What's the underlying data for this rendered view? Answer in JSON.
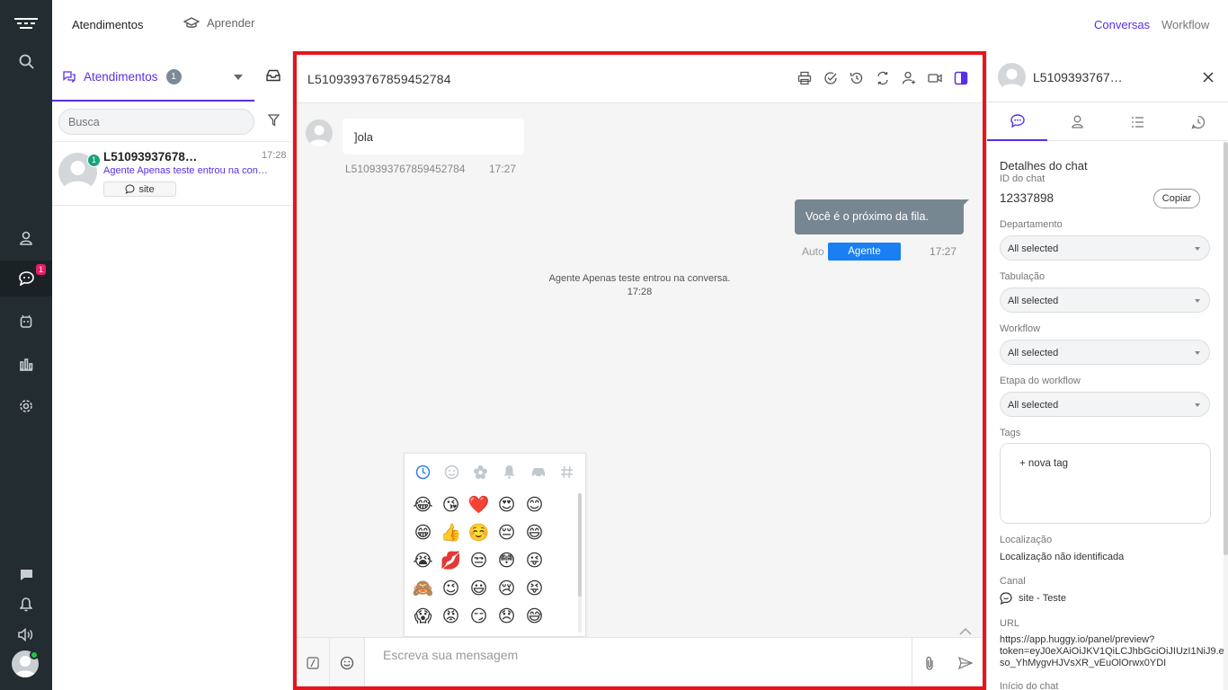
{
  "rail": {
    "items": [
      {
        "name": "huggy-logo-icon"
      },
      {
        "name": "search-icon"
      },
      {
        "name": "contacts-icon"
      },
      {
        "name": "chat-icon",
        "badge": "1"
      },
      {
        "name": "bot-icon"
      },
      {
        "name": "reports-icon"
      },
      {
        "name": "settings-icon"
      },
      {
        "name": "message-icon"
      },
      {
        "name": "bell-icon"
      },
      {
        "name": "speaker-icon"
      }
    ]
  },
  "topbar": {
    "tab_atendimentos": "Atendimentos",
    "tab_aprender": "Aprender",
    "link_conversas": "Conversas",
    "link_workflow": "Workflow"
  },
  "conversations": {
    "tab_label": "Atendimentos",
    "tab_count": "1",
    "search_placeholder": "Busca",
    "items": [
      {
        "name": "L510939376785…",
        "time": "17:28",
        "preview": "Agente Apenas teste entrou na conv…",
        "unread": "1",
        "channel": "site"
      }
    ]
  },
  "chat": {
    "title": "L5109393767859452784",
    "messages": {
      "incoming_text": "]ola",
      "incoming_sender": "L5109393767859452784",
      "incoming_time": "17:27",
      "outgoing_text": "Você é o próximo da fila.",
      "outgoing_auto": "Auto",
      "outgoing_agent": "Agente",
      "outgoing_time": "17:27",
      "system_text": "Agente Apenas teste entrou na conversa.",
      "system_time": "17:28"
    },
    "emoji_picker": {
      "categories": [
        "recent-icon",
        "smiley-icon",
        "flower-icon",
        "bell-icon",
        "car-icon",
        "hashtag-icon"
      ],
      "emojis": [
        "😂",
        "😘",
        "❤️",
        "😍",
        "😊",
        "😁",
        "👍",
        "☺️",
        "😔",
        "😄",
        "😭",
        "💋",
        "😒",
        "😳",
        "😜",
        "🙈",
        "😉",
        "😃",
        "😢",
        "😝",
        "😱",
        "😡",
        "😏",
        "😞",
        "😅"
      ]
    },
    "composer": {
      "placeholder": "Escreva sua mensagem"
    }
  },
  "details": {
    "name": "L5109393767…",
    "section_title": "Detalhes do chat",
    "id_label": "ID do chat",
    "id_value": "12337898",
    "copy_label": "Copiar",
    "departamento_label": "Departamento",
    "departamento_value": "All selected",
    "tabulacao_label": "Tabulação",
    "tabulacao_value": "All selected",
    "workflow_label": "Workflow",
    "workflow_value": "All selected",
    "etapa_label": "Etapa do workflow",
    "etapa_value": "All selected",
    "tags_label": "Tags",
    "new_tag": "+ nova tag",
    "localizacao_label": "Localização",
    "localizacao_value": "Localização não identificada",
    "canal_label": "Canal",
    "canal_value": "site - Teste",
    "url_label": "URL",
    "url_line1": "https://app.huggy.io/panel/preview?",
    "url_line2": "token=eyJ0eXAiOiJKV1QiLCJhbGciOiJIUzI1NiJ9.ey…",
    "url_line3": "so_YhMygvHJVsXR_vEuOlOrwx0YDI",
    "inicio_label": "Início do chat"
  },
  "colors": {
    "accent": "#5a2ee6",
    "rail": "#232c31",
    "highlight_border": "#e8141b",
    "agent_button": "#1a7ff2",
    "outgoing_bubble": "#778791",
    "badge": "#e91e63"
  }
}
